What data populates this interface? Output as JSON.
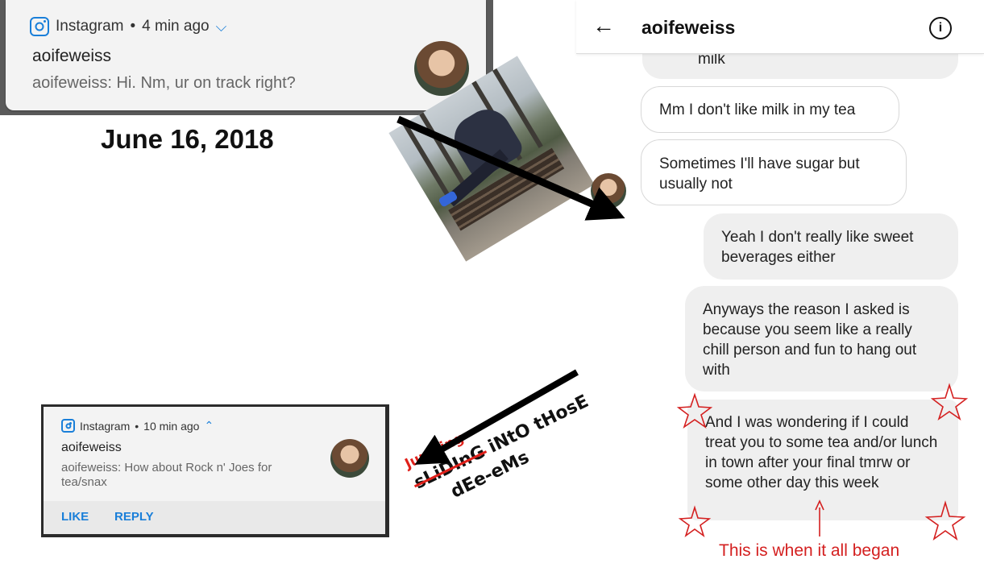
{
  "top_notification": {
    "app": "Instagram",
    "time": "4 min ago",
    "sender": "aoifeweiss",
    "message": "aoifeweiss: Hi. Nm, ur on track right?"
  },
  "date_caption": "June 16, 2018",
  "chat": {
    "title": "aoifeweiss",
    "messages": [
      {
        "from": "them",
        "text": "milk"
      },
      {
        "from": "them",
        "text": "Mm I don't like milk in my tea"
      },
      {
        "from": "them",
        "text": "Sometimes I'll have sugar but usually not"
      },
      {
        "from": "me",
        "text": "Yeah I don't really like sweet beverages either"
      },
      {
        "from": "me",
        "text": "Anyways the reason I asked is because you seem like a really chill person and fun to hang out with"
      },
      {
        "from": "me",
        "text": "And I was wondering if I could treat you to some tea and/or lunch in town after your final tmrw or some other day this week"
      }
    ]
  },
  "bottom_notification": {
    "app": "Instagram",
    "time": "10 min ago",
    "sender": "aoifeweiss",
    "message": "aoifeweiss: How about Rock n' Joes for tea/snax",
    "actions": [
      "LIKE",
      "REPLY"
    ]
  },
  "caption": {
    "correction": "Jumping",
    "struck_word": "sLiDInG",
    "rest_line1": "iNtO tHosE",
    "line2": "dEe-eMs"
  },
  "annotation": "This is when it all began",
  "colors": {
    "instagram_blue": "#1a7fd9",
    "annotation_red": "#d42020"
  }
}
